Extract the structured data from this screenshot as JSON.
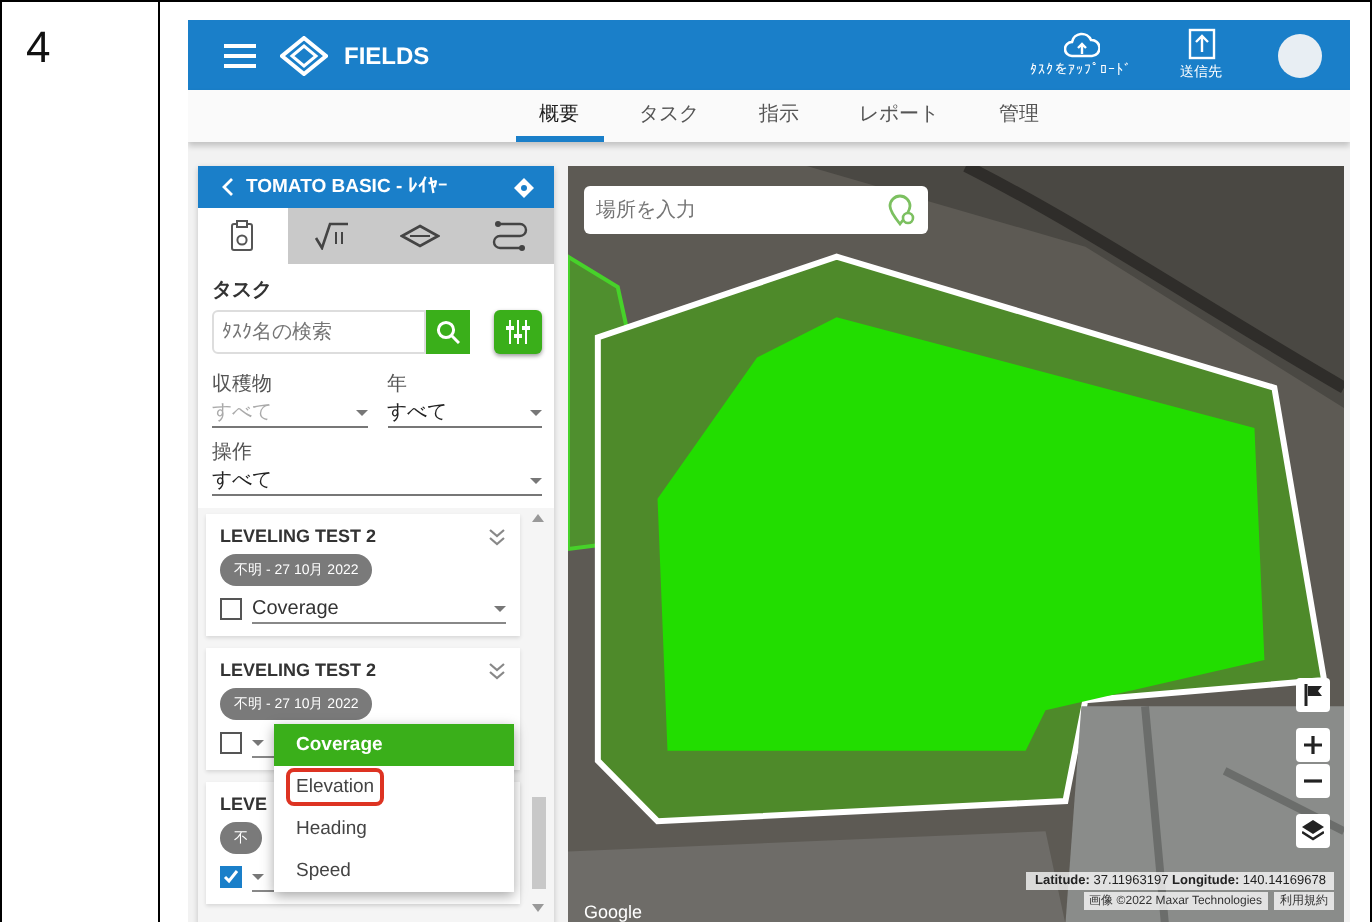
{
  "step": "4",
  "app": {
    "brand": "FIELDS",
    "actions": [
      {
        "kind": "cloud",
        "label": "ﾀｽｸをｱｯﾌﾟﾛｰﾄﾞ"
      },
      {
        "kind": "upload",
        "label": "送信先"
      }
    ]
  },
  "nav": [
    {
      "label": "概要",
      "selected": true
    },
    {
      "label": "タスク",
      "selected": false
    },
    {
      "label": "指示",
      "selected": false
    },
    {
      "label": "レポート",
      "selected": false
    },
    {
      "label": "管理",
      "selected": false
    }
  ],
  "panel": {
    "title": "TOMATO BASIC - ﾚｲﾔｰ",
    "tabs": [
      {
        "kind": "clipboard",
        "selected": true
      },
      {
        "kind": "sqrt",
        "selected": false
      },
      {
        "kind": "layers",
        "selected": false
      },
      {
        "kind": "route",
        "selected": false
      }
    ],
    "section": "タスク",
    "search_placeholder": "ﾀｽｸ名の検索",
    "filters": [
      {
        "label": "収穫物",
        "value": "すべて",
        "disabled": true
      },
      {
        "label": "年",
        "value": "すべて",
        "disabled": false
      }
    ],
    "operation": {
      "label": "操作",
      "value": "すべて"
    },
    "tasks": [
      {
        "title": "LEVELING TEST 2",
        "date": "不明 - 27 10月 2022",
        "checked": false,
        "layer": "Coverage",
        "expand_icon": true
      },
      {
        "title": "LEVELING TEST 2",
        "date": "不明 - 27 10月 2022",
        "checked": false,
        "expand_icon": true
      },
      {
        "title": "LEVE",
        "date": "不",
        "checked": true,
        "expand_icon": false
      }
    ],
    "menu": [
      {
        "label": "Coverage",
        "selected": true,
        "annotated": false
      },
      {
        "label": "Elevation",
        "selected": false,
        "annotated": true
      },
      {
        "label": "Heading",
        "selected": false,
        "annotated": false
      },
      {
        "label": "Speed",
        "selected": false,
        "annotated": false
      }
    ]
  },
  "map": {
    "search_placeholder": "場所を入力",
    "coords": "**Latitude:** 37.11963197 **Longitude:** 140.14169678",
    "attribution": "画像 ©2022 Maxar Technologies",
    "terms": "利用規約",
    "logo": "Google"
  }
}
